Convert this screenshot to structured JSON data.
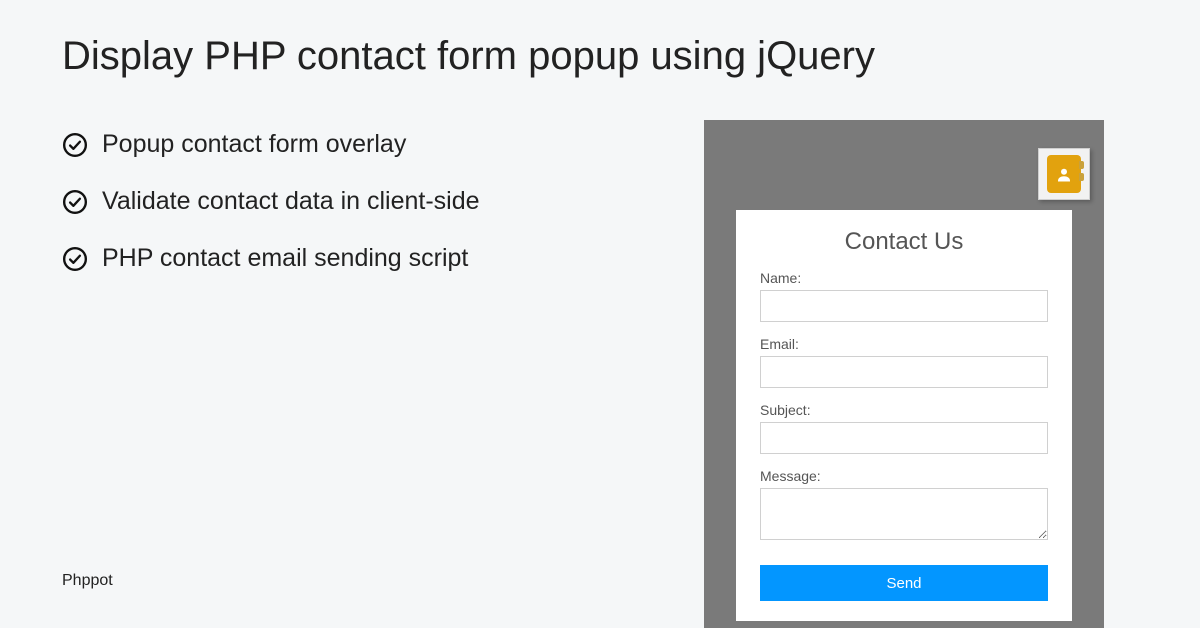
{
  "title": "Display PHP contact form popup using jQuery",
  "features": [
    "Popup contact form overlay",
    "Validate contact data in client-side",
    "PHP contact email sending script"
  ],
  "brand": "Phppot",
  "form": {
    "heading": "Contact Us",
    "name_label": "Name:",
    "email_label": "Email:",
    "subject_label": "Subject:",
    "message_label": "Message:",
    "send_label": "Send",
    "name_value": "",
    "email_value": "",
    "subject_value": "",
    "message_value": ""
  }
}
